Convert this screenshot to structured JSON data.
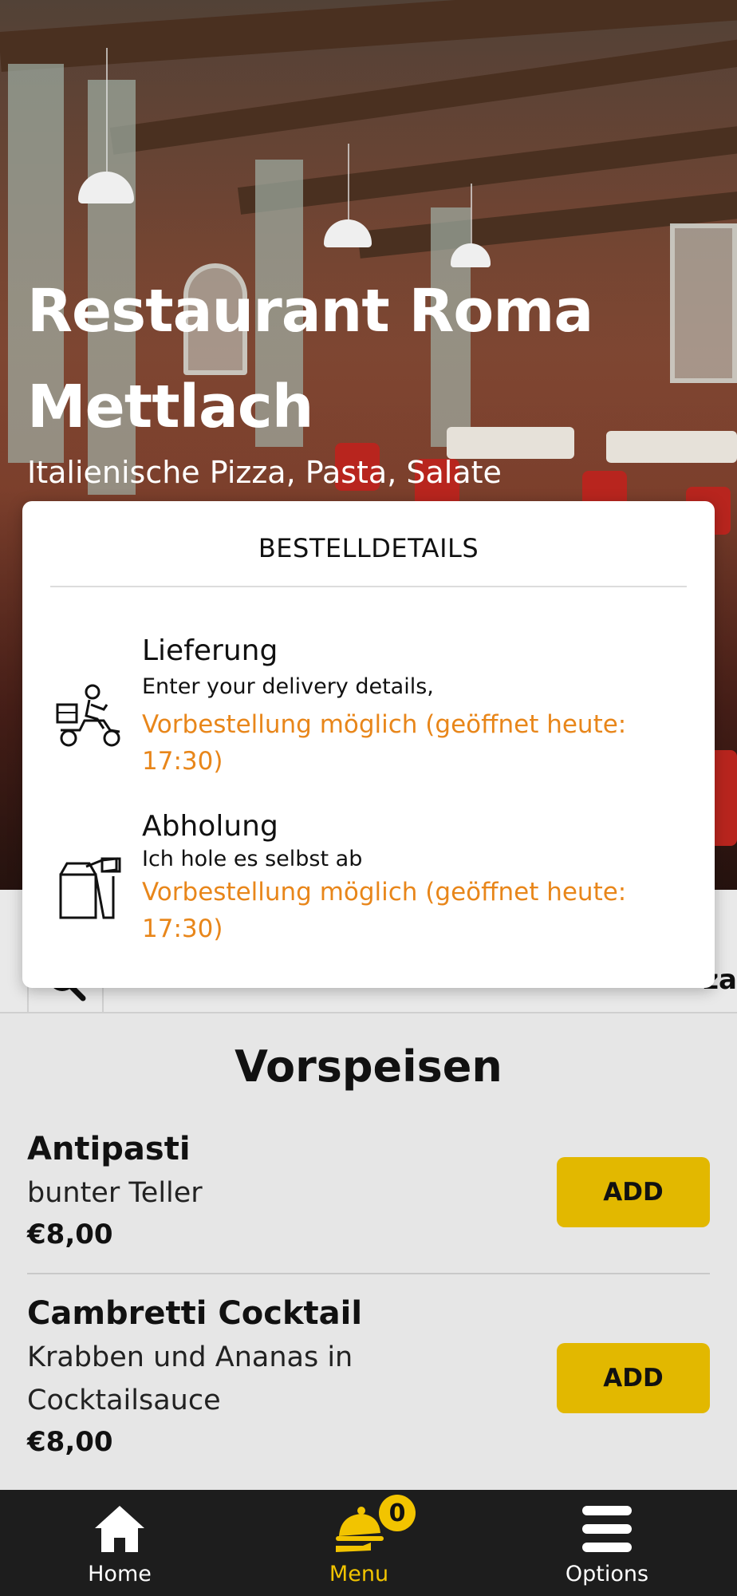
{
  "hero": {
    "title": "Restaurant Roma Mettlach",
    "subtitle": "Italienische Pizza, Pasta, Salate"
  },
  "order_modal": {
    "title": "BESTELLDETAILS",
    "options": [
      {
        "icon": "delivery-scooter-icon",
        "name": "Lieferung",
        "description": "Enter your delivery details,",
        "note": "Vorbestellung möglich (geöffnet heute: 17:30)"
      },
      {
        "icon": "takeaway-bag-icon",
        "name": "Abholung",
        "description": "Ich hole es selbst ab",
        "note": "Vorbestellung möglich (geöffnet heute: 17:30)"
      }
    ]
  },
  "search": {
    "tail_text": "za"
  },
  "menu": {
    "section_title": "Vorspeisen",
    "items": [
      {
        "name": "Antipasti",
        "description": "bunter Teller",
        "price": "€8,00",
        "button": "ADD"
      },
      {
        "name": "Cambretti Cocktail",
        "description": "Krabben und Ananas in Cocktailsauce",
        "price": "€8,00",
        "button": "ADD"
      }
    ]
  },
  "bottom_nav": {
    "items": [
      {
        "label": "Home",
        "icon": "home-icon",
        "active": false
      },
      {
        "label": "Menu",
        "icon": "serving-cloche-icon",
        "active": true,
        "badge": "0"
      },
      {
        "label": "Options",
        "icon": "hamburger-menu-icon",
        "active": false
      }
    ]
  },
  "colors": {
    "accent": "#e2b800",
    "note_orange": "#e8861a",
    "nav_bg": "#1d1d1d",
    "active_nav": "#f2c400"
  }
}
